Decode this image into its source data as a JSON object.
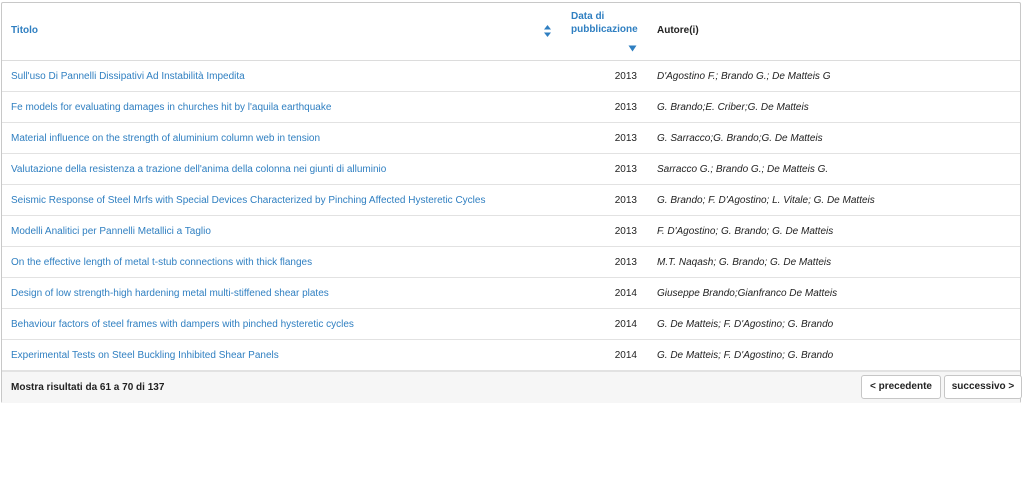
{
  "table": {
    "headers": {
      "title": "Titolo",
      "date_line1": "Data di",
      "date_line2": "pubblicazione",
      "authors": "Autore(i)"
    },
    "rows": [
      {
        "title": "Sull'uso Di Pannelli Dissipativi Ad Instabilità Impedita",
        "year": "2013",
        "authors": "D'Agostino F.; Brando G.; De Matteis G"
      },
      {
        "title": "Fe models for evaluating damages in churches hit by l'aquila earthquake",
        "year": "2013",
        "authors": "G. Brando;E. Criber;G. De Matteis"
      },
      {
        "title": "Material influence on the strength of aluminium column web in tension",
        "year": "2013",
        "authors": "G. Sarracco;G. Brando;G. De Matteis"
      },
      {
        "title": "Valutazione della resistenza a trazione dell'anima della colonna nei giunti di alluminio",
        "year": "2013",
        "authors": "Sarracco G.; Brando G.; De Matteis G."
      },
      {
        "title": "Seismic Response of Steel Mrfs with Special Devices Characterized by Pinching Affected Hysteretic Cycles",
        "year": "2013",
        "authors": "G. Brando; F. D'Agostino; L. Vitale; G. De Matteis"
      },
      {
        "title": "Modelli Analitici per Pannelli Metallici a Taglio",
        "year": "2013",
        "authors": "F. D'Agostino; G. Brando; G. De Matteis"
      },
      {
        "title": "On the effective length of metal t-stub connections with thick flanges",
        "year": "2013",
        "authors": "M.T. Naqash; G. Brando; G. De Matteis"
      },
      {
        "title": "Design of low strength-high hardening metal multi-stiffened shear plates",
        "year": "2014",
        "authors": "Giuseppe Brando;Gianfranco De Matteis"
      },
      {
        "title": "Behaviour factors of steel frames with dampers with pinched hysteretic cycles",
        "year": "2014",
        "authors": "G. De Matteis; F. D'Agostino; G. Brando"
      },
      {
        "title": "Experimental Tests on Steel Buckling Inhibited Shear Panels",
        "year": "2014",
        "authors": "G. De Matteis; F. D'Agostino; G. Brando"
      }
    ]
  },
  "footer": {
    "results_text": "Mostra risultati da 61 a 70 di 137",
    "prev_label": "< precedente",
    "next_label": "successivo >"
  },
  "icons": {
    "sort_both": "sort-both-icon",
    "sort_desc": "sort-desc-icon"
  },
  "colors": {
    "link": "#2f7fc1"
  }
}
